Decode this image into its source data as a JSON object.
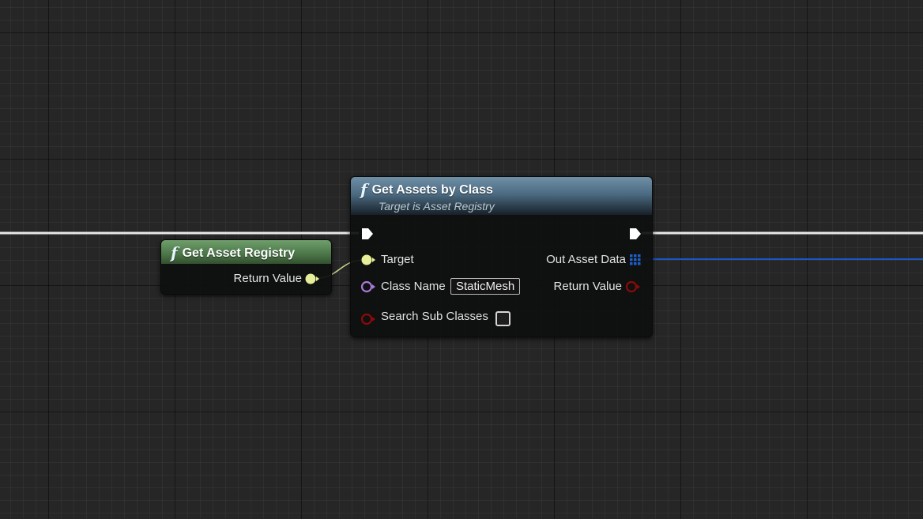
{
  "graph": {
    "background_color": "#262626"
  },
  "nodes": {
    "get_asset_registry": {
      "title": "Get Asset Registry",
      "icon": "function-icon",
      "header_color": "#5f8d5c",
      "pins": {
        "return_value": {
          "label": "Return Value",
          "type": "object",
          "color": "#e7ee9a"
        }
      }
    },
    "get_assets_by_class": {
      "title": "Get Assets by Class",
      "subtitle": "Target is Asset Registry",
      "icon": "function-icon",
      "header_color": "#5d7d94",
      "pins": {
        "exec_in": {
          "type": "exec",
          "color": "#ffffff"
        },
        "exec_out": {
          "type": "exec",
          "color": "#ffffff"
        },
        "target": {
          "label": "Target",
          "type": "object",
          "color": "#e7ee9a"
        },
        "class_name": {
          "label": "Class Name",
          "default_value": "StaticMesh",
          "type": "name",
          "color": "#a779d6"
        },
        "search_sub_classes": {
          "label": "Search Sub Classes",
          "type": "bool",
          "checked": false,
          "color": "#8c0a0a"
        },
        "out_asset_data": {
          "label": "Out Asset Data",
          "type": "array",
          "color": "#1f5fc8"
        },
        "return_value": {
          "label": "Return Value",
          "type": "bool",
          "color": "#8c0a0a"
        }
      }
    }
  },
  "wires": {
    "exec_color": "#e8e8e8",
    "registry_to_target_color": "#d2d68c",
    "asset_data_color": "#1b56c2"
  }
}
